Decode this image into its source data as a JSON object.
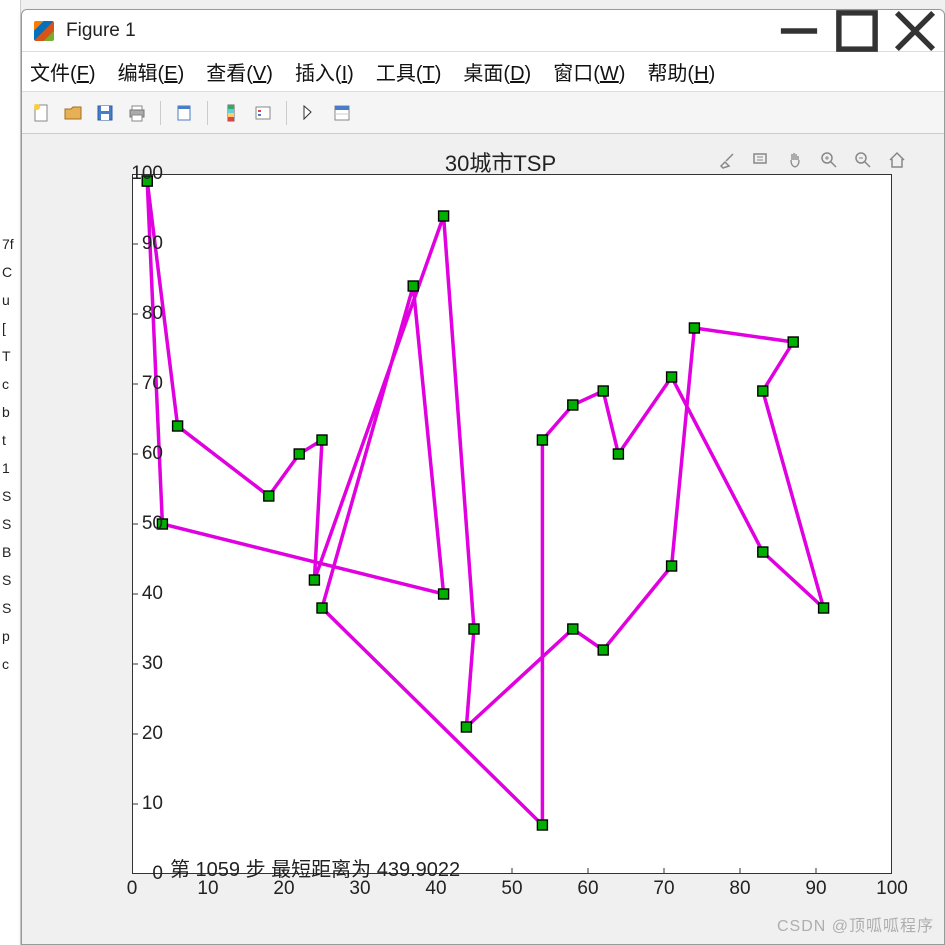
{
  "window": {
    "title": "Figure 1"
  },
  "menubar": {
    "file": "文件(F)",
    "edit": "编辑(E)",
    "view": "查看(V)",
    "insert": "插入(I)",
    "tools": "工具(T)",
    "desktop": "桌面(D)",
    "window": "窗口(W)",
    "help": "帮助(H)"
  },
  "chart_data": {
    "type": "line",
    "title": "30城市TSP",
    "xlabel": "",
    "ylabel": "",
    "xlim": [
      0,
      100
    ],
    "ylim": [
      0,
      100
    ],
    "xticks": [
      0,
      10,
      20,
      30,
      40,
      50,
      60,
      70,
      80,
      90,
      100
    ],
    "yticks": [
      0,
      10,
      20,
      30,
      40,
      50,
      60,
      70,
      80,
      90,
      100
    ],
    "series": [
      {
        "name": "tsp-route",
        "line_color": "#e000e0",
        "marker_color": "#00b000",
        "closed": true,
        "x": [
          2,
          6,
          18,
          22,
          25,
          24,
          41,
          45,
          44,
          58,
          62,
          71,
          74,
          87,
          83,
          91,
          83,
          71,
          64,
          62,
          58,
          54,
          54,
          25,
          37,
          41,
          4,
          2
        ],
        "y": [
          99,
          64,
          54,
          60,
          62,
          42,
          94,
          35,
          21,
          35,
          32,
          44,
          78,
          76,
          69,
          38,
          46,
          71,
          60,
          69,
          67,
          62,
          7,
          38,
          84,
          40,
          50,
          99
        ]
      }
    ],
    "annotation": {
      "step": 1059,
      "distance": 439.9022,
      "text_template": "第 {step} 步  最短距离为 {dist}"
    }
  },
  "left_sidebar_chars": [
    "7f",
    "C",
    "u",
    "[",
    "T",
    "c",
    "b",
    "t",
    "1",
    "S",
    "S",
    "B",
    "S",
    "S",
    "p",
    "c"
  ],
  "watermark": "CSDN @顶呱呱程序"
}
